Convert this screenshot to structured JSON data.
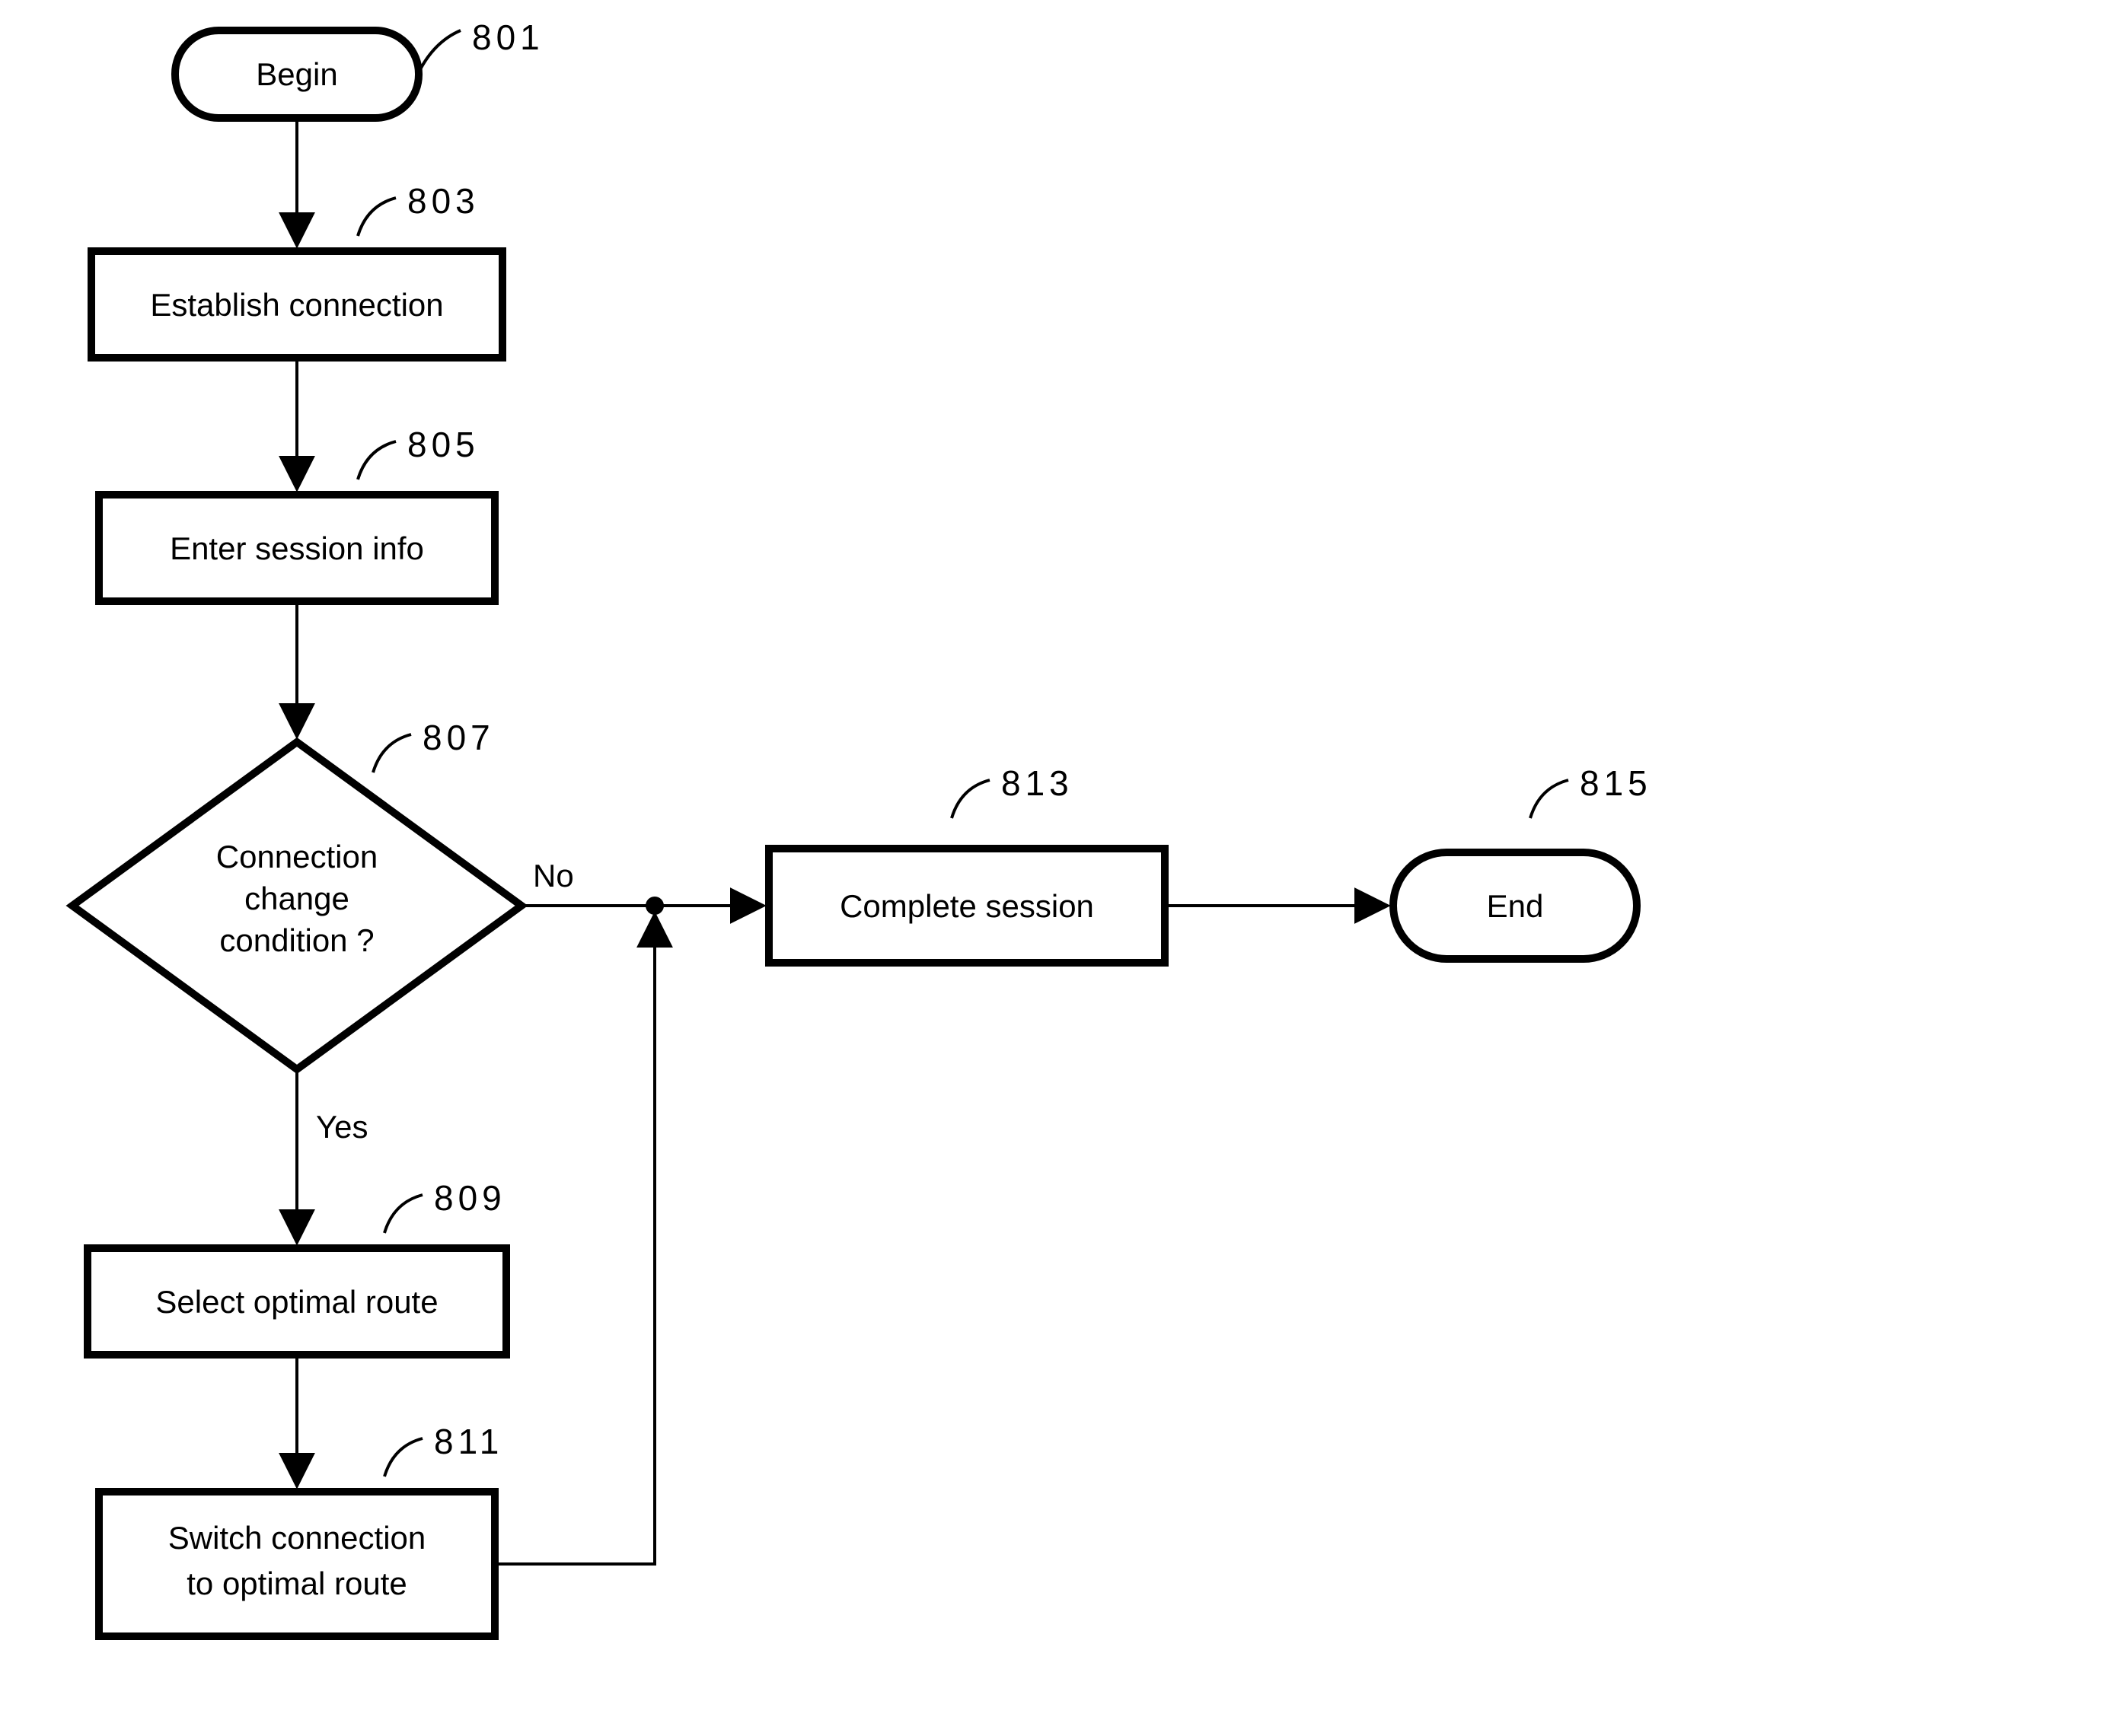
{
  "nodes": {
    "begin": {
      "label": "Begin",
      "ref": "801"
    },
    "n803": {
      "label": "Establish connection",
      "ref": "803"
    },
    "n805": {
      "label": "Enter session info",
      "ref": "805"
    },
    "n807": {
      "line1": "Connection",
      "line2": "change",
      "line3": "condition ?",
      "ref": "807"
    },
    "n809": {
      "label": "Select optimal route",
      "ref": "809"
    },
    "n811": {
      "line1": "Switch connection",
      "line2": "to optimal route",
      "ref": "811"
    },
    "n813": {
      "label": "Complete session",
      "ref": "813"
    },
    "end": {
      "label": "End",
      "ref": "815"
    }
  },
  "edges": {
    "yes": "Yes",
    "no": "No"
  }
}
